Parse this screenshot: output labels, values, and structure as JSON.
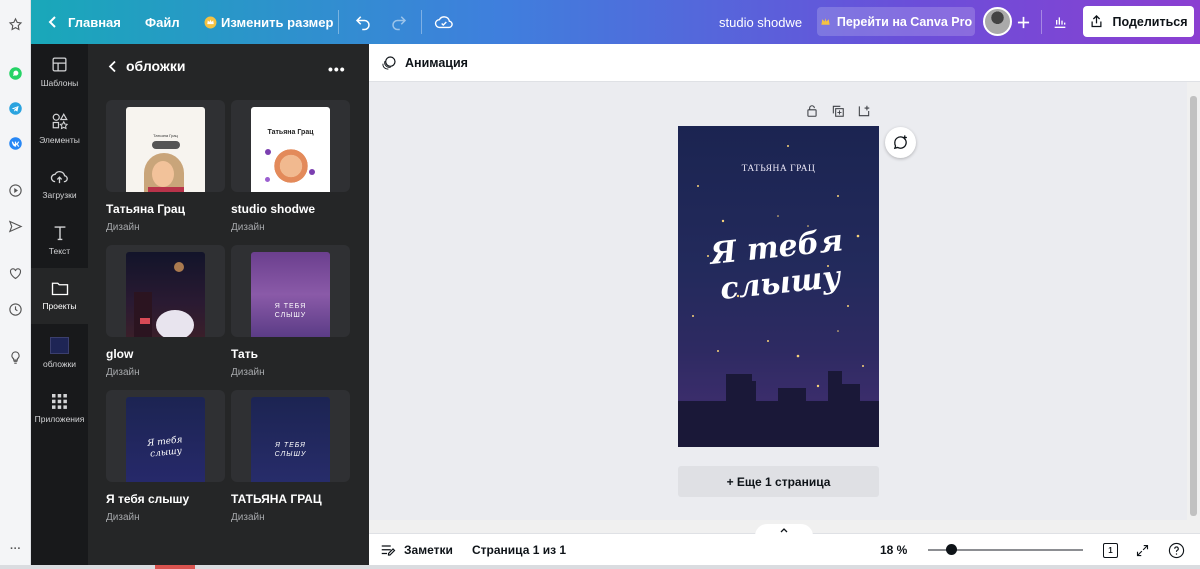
{
  "topbar": {
    "home_label": "Главная",
    "file_label": "Файл",
    "resize_label": "Изменить размер",
    "design_name": "studio shodwe",
    "pro_label": "Перейти на Canva Pro",
    "share_label": "Поделиться"
  },
  "rail": {
    "items": [
      {
        "label": "Шаблоны",
        "icon": "layout-icon"
      },
      {
        "label": "Элементы",
        "icon": "shapes-icon"
      },
      {
        "label": "Загрузки",
        "icon": "cloud-upload-icon"
      },
      {
        "label": "Текст",
        "icon": "text-icon"
      },
      {
        "label": "Проекты",
        "icon": "folder-icon"
      },
      {
        "label": "обложки",
        "icon": "cover-thumb-icon"
      },
      {
        "label": "Приложения",
        "icon": "apps-grid-icon"
      }
    ]
  },
  "panel": {
    "title": "обложки",
    "designs": [
      {
        "title": "Татьяна Грац",
        "type": "Дизайн",
        "thumb_text": "Татьяна Грац"
      },
      {
        "title": "studio shodwe",
        "type": "Дизайн",
        "thumb_text": "Татьяна Грац"
      },
      {
        "title": "glow",
        "type": "Дизайн",
        "thumb_text": ""
      },
      {
        "title": "Тать",
        "type": "Дизайн",
        "thumb_text": "Я ТЕБЯ СЛЫШУ"
      },
      {
        "title": "Я тебя слышу",
        "type": "Дизайн",
        "thumb_text": "Я тебя слышу"
      },
      {
        "title": "ТАТЬЯНА ГРАЦ",
        "type": "Дизайн",
        "thumb_text": "Я ТЕБЯ СЛЫШУ"
      }
    ]
  },
  "editor": {
    "animation_label": "Анимация",
    "page_author": "ТАТЬЯНА ГРАЦ",
    "page_title_line1": "Я тебя",
    "page_title_line2": "слышу",
    "add_page_label": "+ Еще 1 страница"
  },
  "bottombar": {
    "notes_label": "Заметки",
    "page_indicator": "Страница 1 из 1",
    "zoom": "18 %",
    "zoom_fraction": 0.15,
    "page_count_badge": "1"
  },
  "colors": {
    "accent_gradient_start": "#19a8b9",
    "accent_gradient_end": "#8b3fd1",
    "panel_bg": "#252627",
    "rail_bg": "#18191b",
    "crown": "#f5c242"
  }
}
